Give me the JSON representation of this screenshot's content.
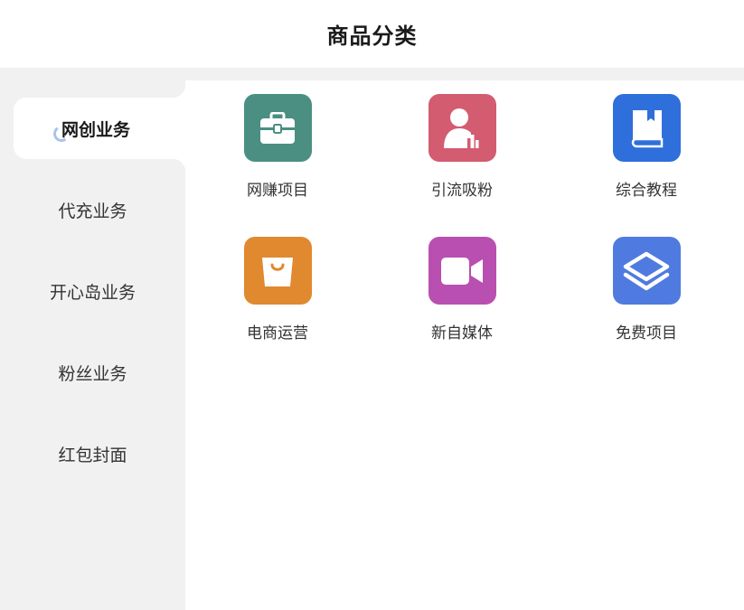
{
  "header": {
    "title": "商品分类"
  },
  "sidebar": {
    "items": [
      {
        "label": "网创业务",
        "active": true
      },
      {
        "label": "代充业务",
        "active": false
      },
      {
        "label": "开心岛业务",
        "active": false
      },
      {
        "label": "粉丝业务",
        "active": false
      },
      {
        "label": "红包封面",
        "active": false
      }
    ]
  },
  "categories": [
    {
      "label": "网赚项目",
      "icon": "briefcase-icon",
      "color": "#4a8f82"
    },
    {
      "label": "引流吸粉",
      "icon": "user-chart-icon",
      "color": "#d35c70"
    },
    {
      "label": "综合教程",
      "icon": "book-icon",
      "color": "#2f6fdb"
    },
    {
      "label": "电商运营",
      "icon": "shopping-bag-icon",
      "color": "#e0892e"
    },
    {
      "label": "新自媒体",
      "icon": "video-camera-icon",
      "color": "#b94fb0"
    },
    {
      "label": "免费项目",
      "icon": "layers-icon",
      "color": "#4f7be0"
    }
  ]
}
